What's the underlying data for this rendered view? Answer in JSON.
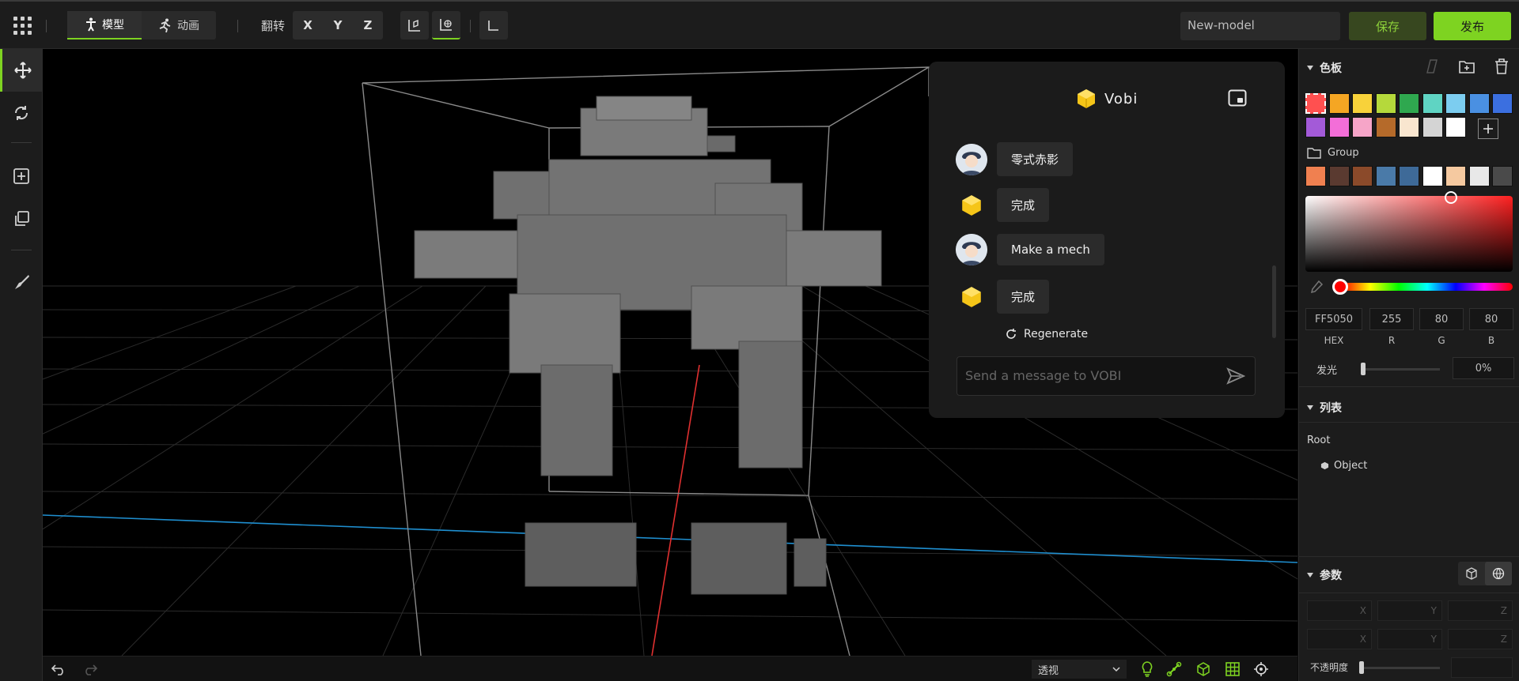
{
  "topbar": {
    "modes": [
      {
        "label": "模型",
        "icon": "standing-figure-icon",
        "active": true
      },
      {
        "label": "动画",
        "icon": "running-figure-icon",
        "active": false
      }
    ],
    "flip_label": "翻转",
    "axes": [
      "X",
      "Y",
      "Z"
    ],
    "model_name": "New-model",
    "save_label": "保存",
    "publish_label": "发布",
    "accent_color": "#7ed321"
  },
  "left_toolbar": [
    "move-icon",
    "rotate-icon",
    "add-icon",
    "duplicate-icon",
    "paint-icon"
  ],
  "chat": {
    "title": "Vobi",
    "messages": [
      {
        "from": "user",
        "text": "零式赤影"
      },
      {
        "from": "bot",
        "text": "完成"
      },
      {
        "from": "user",
        "text": "Make a mech"
      },
      {
        "from": "bot",
        "text": "完成"
      }
    ],
    "regenerate_label": "Regenerate",
    "input_placeholder": "Send a message to VOBI"
  },
  "bottombar": {
    "view_mode": "透视"
  },
  "right_panel": {
    "palette_title": "色板",
    "palette": [
      "#ff5050",
      "#f5a623",
      "#f8d23a",
      "#b5d93b",
      "#2fa84f",
      "#5fd4c3",
      "#7ccdf0",
      "#4a90e2",
      "#3b6fe0",
      "#a35ad8",
      "#f36ed8",
      "#f6a5c8",
      "#b56a2a",
      "#f9e6cf",
      "#d4d4d4",
      "#ffffff"
    ],
    "group_label": "Group",
    "group_palette": [
      "#f08050",
      "#5a3a30",
      "#8b4a2a",
      "#4a7aa8",
      "#3e6a98",
      "#ffffff",
      "#f5c9a0",
      "#e8e8e8",
      "#4a4a4a"
    ],
    "hex_value": "FF5050",
    "r_value": "255",
    "g_value": "80",
    "b_value": "80",
    "labels": {
      "hex": "HEX",
      "r": "R",
      "g": "G",
      "b": "B"
    },
    "emission_label": "发光",
    "emission_value": "0%",
    "list_title": "列表",
    "tree_root": "Root",
    "tree_object": "Object",
    "params_title": "参数",
    "axis_labels": [
      "X",
      "Y",
      "Z"
    ],
    "opacity_label": "不透明度"
  }
}
